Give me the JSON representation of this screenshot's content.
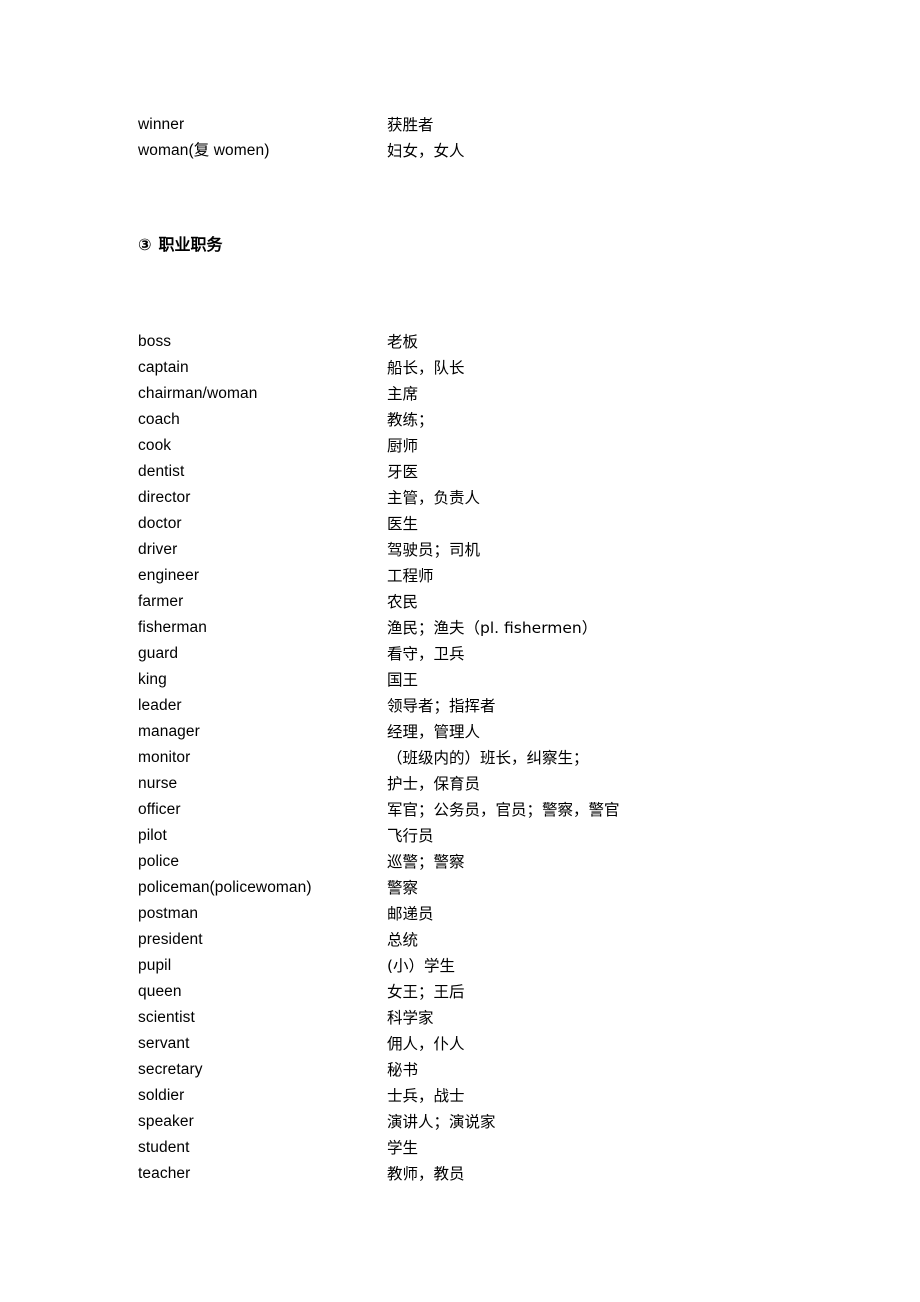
{
  "page": {
    "background": "#ffffff",
    "text_color": "#000000"
  },
  "tail_section": {
    "entries": [
      {
        "term": "winner",
        "gloss": "获胜者"
      },
      {
        "term": "woman(复 women)",
        "gloss": "妇女，女人"
      }
    ]
  },
  "section": {
    "marker": "③",
    "title": "职业职务"
  },
  "vocabulary": {
    "entries": [
      {
        "term": "boss",
        "gloss": "老板"
      },
      {
        "term": "captain",
        "gloss": "船长，队长"
      },
      {
        "term": "chairman/woman",
        "gloss": "主席"
      },
      {
        "term": "coach",
        "gloss": "教练；"
      },
      {
        "term": "cook",
        "gloss": "厨师"
      },
      {
        "term": "dentist",
        "gloss": "牙医"
      },
      {
        "term": "director",
        "gloss": "主管，负责人"
      },
      {
        "term": "doctor",
        "gloss": "医生"
      },
      {
        "term": "driver",
        "gloss": "驾驶员；司机"
      },
      {
        "term": "engineer",
        "gloss": "工程师"
      },
      {
        "term": "farmer",
        "gloss": "农民"
      },
      {
        "term": "fisherman",
        "gloss": "渔民；渔夫（pl. fishermen）"
      },
      {
        "term": "guard",
        "gloss": "看守，卫兵"
      },
      {
        "term": "king",
        "gloss": "国王"
      },
      {
        "term": "leader",
        "gloss": "领导者；指挥者"
      },
      {
        "term": "manager",
        "gloss": "经理，管理人"
      },
      {
        "term": "monitor",
        "gloss": "（班级内的）班长，纠察生；"
      },
      {
        "term": "nurse",
        "gloss": "护士，保育员"
      },
      {
        "term": "officer",
        "gloss": "军官；公务员，官员；警察，警官"
      },
      {
        "term": "pilot",
        "gloss": "飞行员"
      },
      {
        "term": "police",
        "gloss": "巡警；警察"
      },
      {
        "term": "policeman(policewoman)",
        "gloss": "警察"
      },
      {
        "term": "postman",
        "gloss": "邮递员"
      },
      {
        "term": "president",
        "gloss": "总统"
      },
      {
        "term": "pupil",
        "gloss": "(小）学生"
      },
      {
        "term": "queen",
        "gloss": "女王；王后"
      },
      {
        "term": "scientist",
        "gloss": "科学家"
      },
      {
        "term": "servant",
        "gloss": "佣人，仆人"
      },
      {
        "term": "secretary",
        "gloss": "秘书"
      },
      {
        "term": "soldier",
        "gloss": "士兵，战士"
      },
      {
        "term": "speaker",
        "gloss": "演讲人；演说家"
      },
      {
        "term": "student",
        "gloss": "学生"
      },
      {
        "term": "teacher",
        "gloss": "教师，教员"
      }
    ]
  }
}
